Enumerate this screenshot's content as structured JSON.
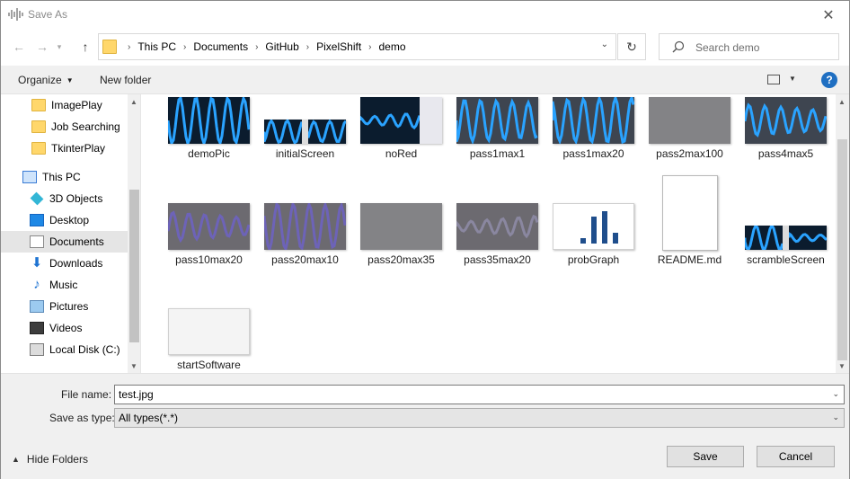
{
  "window": {
    "title": "Save As",
    "close_glyph": "✕"
  },
  "nav": {
    "back_glyph": "←",
    "forward_glyph": "→",
    "recent_glyph": "▾",
    "up_glyph": "↑",
    "breadcrumbs": [
      "This PC",
      "Documents",
      "GitHub",
      "PixelShift",
      "demo"
    ],
    "separator": "›",
    "dropdown_glyph": "⌄",
    "refresh_glyph": "↻",
    "search_placeholder": "Search demo"
  },
  "toolbar": {
    "organize": "Organize",
    "new_folder": "New folder",
    "help": "?"
  },
  "sidebar": {
    "items": [
      {
        "label": "ImagePlay",
        "icon": "folder-icon"
      },
      {
        "label": "Job Searching",
        "icon": "folder-icon"
      },
      {
        "label": "TkinterPlay",
        "icon": "folder-icon"
      },
      {
        "label": "This PC",
        "icon": "computer-icon"
      },
      {
        "label": "3D Objects",
        "icon": "cube-icon"
      },
      {
        "label": "Desktop",
        "icon": "desktop-icon"
      },
      {
        "label": "Documents",
        "icon": "document-icon",
        "selected": true
      },
      {
        "label": "Downloads",
        "icon": "download-icon"
      },
      {
        "label": "Music",
        "icon": "music-icon"
      },
      {
        "label": "Pictures",
        "icon": "pictures-icon"
      },
      {
        "label": "Videos",
        "icon": "video-icon"
      },
      {
        "label": "Local Disk (C:)",
        "icon": "disk-icon"
      }
    ]
  },
  "files": [
    {
      "name": "demoPic",
      "kind": "wave"
    },
    {
      "name": "initialScreen",
      "kind": "split-wave"
    },
    {
      "name": "noRed",
      "kind": "wave-palette"
    },
    {
      "name": "pass1max1",
      "kind": "wave-noisy"
    },
    {
      "name": "pass1max20",
      "kind": "wave-noisy"
    },
    {
      "name": "pass2max100",
      "kind": "noise"
    },
    {
      "name": "pass4max5",
      "kind": "wave-noisy"
    },
    {
      "name": "pass10max20",
      "kind": "wave-purple"
    },
    {
      "name": "pass20max10",
      "kind": "wave-purple"
    },
    {
      "name": "pass20max35",
      "kind": "noise"
    },
    {
      "name": "pass35max20",
      "kind": "noise-wave"
    },
    {
      "name": "probGraph",
      "kind": "graph"
    },
    {
      "name": "README.md",
      "kind": "document"
    },
    {
      "name": "scrambleScreen",
      "kind": "split-wave"
    },
    {
      "name": "startSoftware",
      "kind": "screenshot"
    }
  ],
  "form": {
    "file_name_label": "File name:",
    "file_name_value": "test.jpg",
    "save_type_label": "Save as type:",
    "save_type_value": "All types(*.*)",
    "hide_folders": "Hide Folders",
    "save": "Save",
    "cancel": "Cancel"
  },
  "colors": {
    "accent": "#1f6fc2",
    "folder": "#ffd76b",
    "wave": "#2aa3ff",
    "selected_bg": "#e5e5e5"
  }
}
